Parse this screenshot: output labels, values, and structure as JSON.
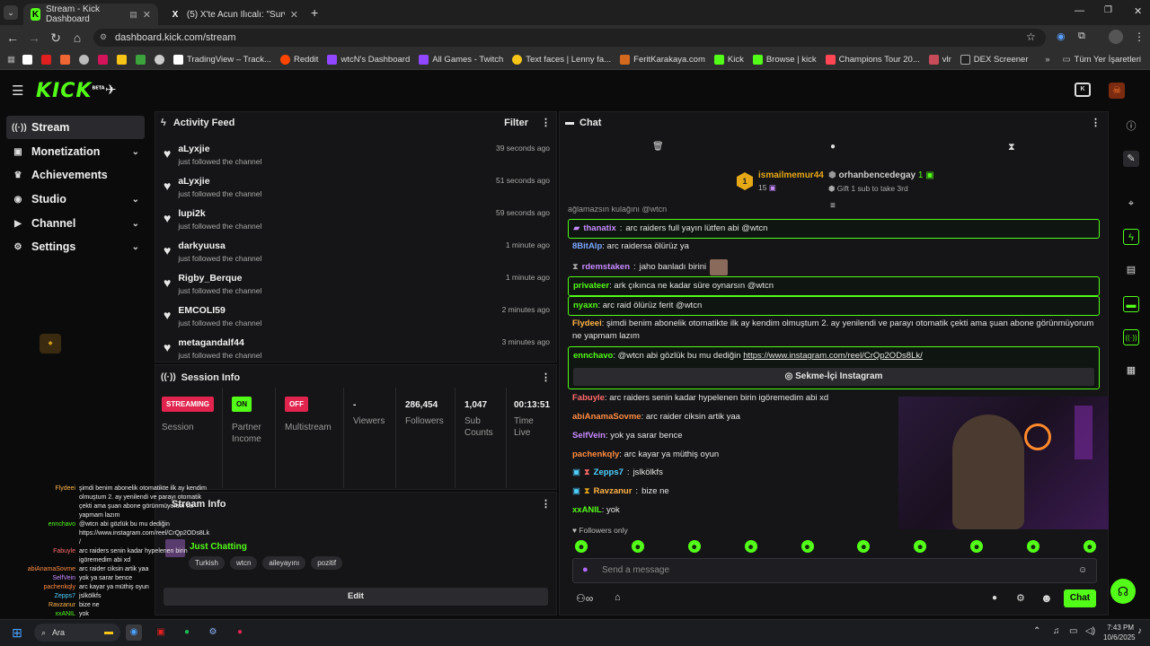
{
  "browser": {
    "tabs": [
      {
        "title": "Stream - Kick Dashboard",
        "active": true
      },
      {
        "title": "(5) X'te Acun Ilıcalı: \"Survivor 20",
        "active": false
      }
    ],
    "url": "dashboard.kick.com/stream",
    "bookmarks": [
      "TradingView – Track...",
      "Reddit",
      "wtcN's Dashboard",
      "All Games - Twitch",
      "Text faces | Lenny fa...",
      "FeritKarakaya.com",
      "Kick",
      "Browse | kick",
      "Champions Tour 20...",
      "vlr",
      "DEX Screener"
    ],
    "all_bookmarks": "Tüm Yer İşaretleri"
  },
  "app": {
    "logo": "KICK",
    "logo_beta": "BETA",
    "accent": "#53fc18"
  },
  "sidebar": {
    "items": [
      {
        "label": "Stream",
        "icon": "broadcast-icon",
        "active": true
      },
      {
        "label": "Monetization",
        "icon": "money-icon"
      },
      {
        "label": "Achievements",
        "icon": "trophy-icon"
      },
      {
        "label": "Studio",
        "icon": "studio-icon"
      },
      {
        "label": "Channel",
        "icon": "channel-icon"
      },
      {
        "label": "Settings",
        "icon": "gear-icon"
      }
    ]
  },
  "activity": {
    "title": "Activity Feed",
    "filter": "Filter",
    "items": [
      {
        "name": "aLyxjie",
        "action": "just followed the channel",
        "time": "39 seconds ago"
      },
      {
        "name": "aLyxjie",
        "action": "just followed the channel",
        "time": "51 seconds ago"
      },
      {
        "name": "lupi2k",
        "action": "just followed the channel",
        "time": "59 seconds ago"
      },
      {
        "name": "darkyuusa",
        "action": "just followed the channel",
        "time": "1 minute ago"
      },
      {
        "name": "Rigby_Berque",
        "action": "just followed the channel",
        "time": "1 minute ago"
      },
      {
        "name": "EMCOLI59",
        "action": "just followed the channel",
        "time": "2 minutes ago"
      },
      {
        "name": "metagandalf44",
        "action": "just followed the channel",
        "time": "3 minutes ago"
      }
    ]
  },
  "session": {
    "title": "Session Info",
    "stats": [
      {
        "value": "STREAMING",
        "label": "Session",
        "badge": true,
        "color": "#e0244d"
      },
      {
        "value": "ON",
        "label": "Partner Income",
        "badge": true,
        "color": "#53fc18"
      },
      {
        "value": "OFF",
        "label": "Multistream",
        "badge": true,
        "color": "#e0244d"
      },
      {
        "value": "-",
        "label": "Viewers"
      },
      {
        "value": "286,454",
        "label": "Followers"
      },
      {
        "value": "1,047",
        "label": "Sub Counts"
      },
      {
        "value": "00:13:51",
        "label": "Time Live"
      }
    ]
  },
  "stream_info": {
    "title": "Stream Info",
    "category": "Just Chatting",
    "tags": [
      "Turkish",
      "wtcn",
      "aileyayını",
      "pozitif"
    ],
    "edit": "Edit"
  },
  "chat": {
    "title": "Chat",
    "gifter": {
      "rank": "1",
      "name": "ismailmemur44",
      "count": "15"
    },
    "gifter2": {
      "name": "orhanbencedegay",
      "count": "1",
      "note": "Gift 1 sub to take 3rd"
    },
    "partial_line": "ağlamazsın kulağını @wtcn",
    "messages": [
      {
        "user": "thanatix",
        "text": "arc raiders full yayın lütfen abi @wtcn",
        "color": "#c98bff",
        "highlight": true
      },
      {
        "user": "8BitAlp",
        "text": "arc raidersa ölürüz ya",
        "color": "#7aa7ff"
      },
      {
        "user": "rdemstaken",
        "text": "jaho banladı birini",
        "color": "#c98bff"
      },
      {
        "user": "privateer",
        "text": "ark çıkınca ne kadar süre oynarsın @wtcn",
        "color": "#53fc18",
        "highlight": true
      },
      {
        "user": "nyaxn",
        "text": "arc raid ölürüz ferit @wtcn",
        "color": "#53fc18",
        "highlight": true
      },
      {
        "user": "Flydeei",
        "text": "şimdi benim abonelik otomatikte ilk ay kendim olmuştum 2. ay yenilendi ve parayı otomatik çekti ama şuan abone görünmüyorum ne yapmam lazım",
        "color": "#ffb347"
      },
      {
        "user": "ennchavo",
        "text": "@wtcn abi gözlük bu mu dediğin",
        "link": "https://www.instagram.com/reel/CrQp2ODs8Lk/",
        "color": "#53fc18",
        "highlight": true,
        "embed": "Sekme-İçi Instagram"
      },
      {
        "user": "Fabuyle",
        "text": "arc raiders senin kadar hypelenen birin igöremedim abi xd",
        "color": "#ff6b6b"
      },
      {
        "user": "abiAnamaSovme",
        "text": "arc raider ciksin artik yaa",
        "color": "#ff8c42"
      },
      {
        "user": "SelfVein",
        "text": "yok ya sarar bence",
        "color": "#c98bff"
      },
      {
        "user": "pachenkqly",
        "text": "arc kayar ya müthiş oyun",
        "color": "#ff8c42"
      },
      {
        "user": "Zepps7",
        "text": "jslkölkfs",
        "color": "#4fd1ff"
      },
      {
        "user": "Ravzanur",
        "text": "bize ne",
        "color": "#ffb347"
      },
      {
        "user": "xxANIL",
        "text": "yok",
        "color": "#53fc18"
      }
    ],
    "followers_only": "Followers only",
    "placeholder": "Send a message",
    "send": "Chat"
  },
  "overlay": {
    "lines": [
      {
        "n": "Flydeei",
        "t": "şimdi benim abonelik otomatikte ilk ay kendim"
      },
      {
        "n": "",
        "t": "olmuştum 2. ay yenilendi ve parayı otomatik"
      },
      {
        "n": "",
        "t": "çekti ama şuan abone görünmüyorum ne"
      },
      {
        "n": "",
        "t": "yapmam lazım"
      },
      {
        "n": "ennchavo",
        "t": "@wtcn abi gözlük bu mu dediğin"
      },
      {
        "n": "",
        "t": "https://www.instagram.com/reel/CrQp2ODs8Lk"
      },
      {
        "n": "",
        "t": "/"
      },
      {
        "n": "Fabuyle",
        "t": "arc raiders senin kadar hypelenen birin"
      },
      {
        "n": "",
        "t": "igöremedim abi xd"
      },
      {
        "n": "abiAnamaSovme",
        "t": "arc raider ciksin artik yaa"
      },
      {
        "n": "SelfVein",
        "t": "yok ya sarar bence"
      },
      {
        "n": "pachenkqly",
        "t": "arc kayar ya müthiş oyun"
      },
      {
        "n": "Zepps7",
        "t": "jslkölkfs"
      },
      {
        "n": "Ravzanur",
        "t": "bize ne"
      },
      {
        "n": "xxANIL",
        "t": "yok"
      }
    ]
  },
  "taskbar": {
    "search": "Ara",
    "time": "7:43 PM",
    "date": "10/6/2025"
  }
}
